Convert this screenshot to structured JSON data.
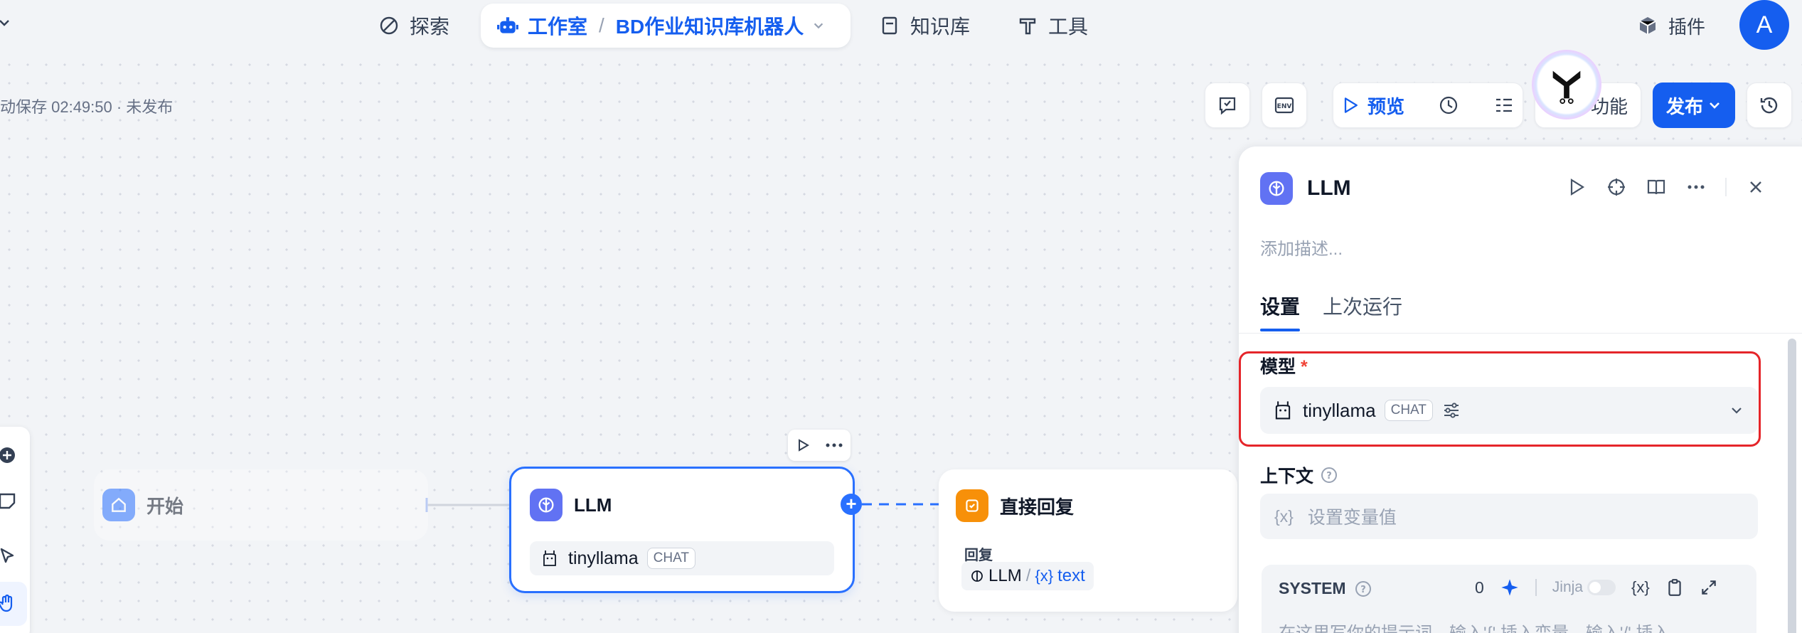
{
  "nav": {
    "explore": "探索",
    "studio": "工作室",
    "app_name": "BD作业知识库机器人",
    "knowledge": "知识库",
    "tools": "工具",
    "plugins": "插件",
    "avatar_letter": "A"
  },
  "toolbar": {
    "autosave": "动保存 02:49:50 · 未发布",
    "preview": "预览",
    "features": "功能",
    "publish": "发布"
  },
  "nodes": {
    "start": "开始",
    "llm": {
      "title": "LLM",
      "model": "tinyllama",
      "mode": "CHAT"
    },
    "reply": {
      "title": "直接回复",
      "label": "回复",
      "var_node": "LLM",
      "var_sep": "/",
      "var_name": "text"
    }
  },
  "panel": {
    "title": "LLM",
    "description_placeholder": "添加描述...",
    "tabs": [
      "设置",
      "上次运行"
    ],
    "model_label": "模型",
    "required_mark": "*",
    "model_name": "tinyllama",
    "model_mode": "CHAT",
    "context_label": "上下文",
    "context_placeholder": "设置变量值",
    "system": {
      "label": "SYSTEM",
      "count": "0",
      "jinja": "Jinja",
      "placeholder": "在这里写你的提示词，输入'{' 插入变量、输入'/' 插入..."
    }
  },
  "colors": {
    "accent": "#155eef",
    "llm_node_border": "#2970ff",
    "reply_icon": "#f79009",
    "llm_icon": "#6172f3",
    "highlight_box": "#e5252a"
  }
}
